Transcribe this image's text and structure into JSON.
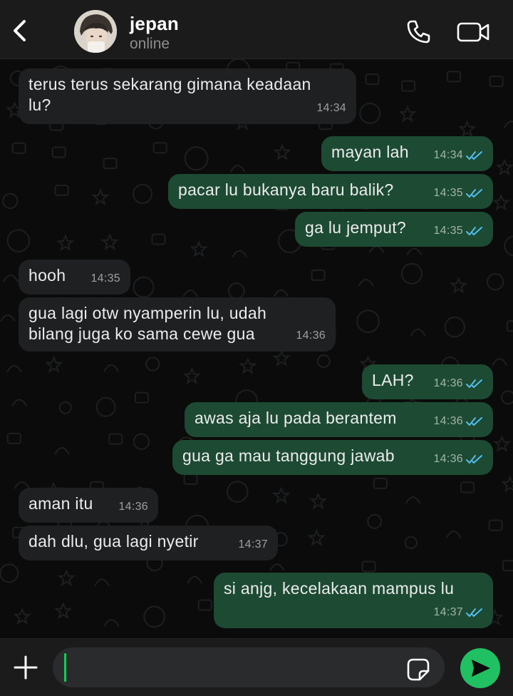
{
  "header": {
    "contact_name": "jepan",
    "status": "online"
  },
  "theme": {
    "header_bg": "#1b1b1b",
    "chat_bg": "#0b0b0b",
    "incoming_bubble": "#1f2022",
    "outgoing_bubble": "#1c4a33",
    "read_tick": "#53bdeb",
    "accent": "#21c063"
  },
  "messages": [
    {
      "direction": "in",
      "text": "terus terus sekarang gimana keadaan\nlu?",
      "time": "14:34"
    },
    {
      "direction": "out",
      "text": "mayan lah",
      "time": "14:34",
      "status": "read"
    },
    {
      "direction": "out",
      "text": "pacar lu bukanya baru balik?",
      "time": "14:35",
      "status": "read"
    },
    {
      "direction": "out",
      "text": "ga lu jemput?",
      "time": "14:35",
      "status": "read"
    },
    {
      "direction": "in",
      "text": "hooh",
      "time": "14:35"
    },
    {
      "direction": "in",
      "text": "gua lagi otw nyamperin lu, udah\nbilang juga ko sama cewe gua",
      "time": "14:36"
    },
    {
      "direction": "out",
      "text": "LAH?",
      "time": "14:36",
      "status": "read"
    },
    {
      "direction": "out",
      "text": "awas aja lu pada berantem",
      "time": "14:36",
      "status": "read"
    },
    {
      "direction": "out",
      "text": "gua ga mau tanggung jawab",
      "time": "14:36",
      "status": "read"
    },
    {
      "direction": "in",
      "text": "aman itu",
      "time": "14:36"
    },
    {
      "direction": "in",
      "text": "dah dlu, gua lagi nyetir",
      "time": "14:37"
    },
    {
      "direction": "out",
      "text": "si anjg, kecelakaan mampus lu",
      "time": "14:37",
      "status": "read"
    }
  ],
  "composer": {
    "value": "",
    "placeholder": ""
  },
  "icons": {
    "back": "chevron-left-icon",
    "call": "phone-icon",
    "video": "video-camera-icon",
    "attach": "plus-icon",
    "sticker": "sticker-icon",
    "send": "send-icon",
    "read_receipt": "double-check-icon"
  }
}
